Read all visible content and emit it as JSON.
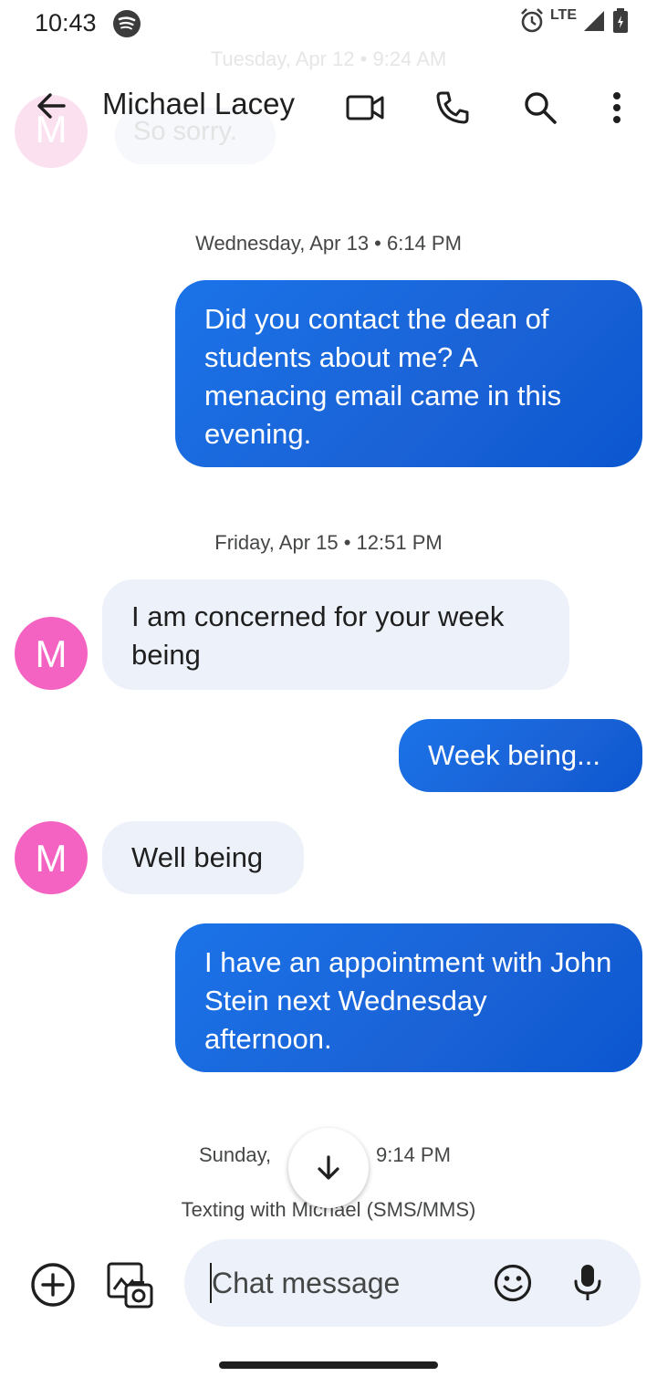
{
  "status_bar": {
    "time": "10:43",
    "network": "LTE"
  },
  "background": {
    "previous_date": "Tuesday, Apr 12 • 9:24 AM",
    "previous_message": "So sorry.",
    "previous_avatar": "M"
  },
  "header": {
    "title": "Michael Lacey",
    "icons": [
      "back-arrow-icon",
      "video-call-icon",
      "phone-icon",
      "search-icon",
      "more-vert-icon"
    ]
  },
  "conversation": {
    "date_wed": "Wednesday, Apr 13 • 6:14 PM",
    "msg1": "Did you contact the dean of students about me? A menacing email came in this evening.",
    "date_fri": "Friday, Apr 15 • 12:51 PM",
    "msg2": "I am concerned for your week being",
    "msg3": "Week being...",
    "msg4": "Well being",
    "msg5": "I have an appointment with John Stein next Wednesday afternoon.",
    "date_sun_left": "Sunday,",
    "date_sun_right": "9:14 PM",
    "texting_info": "Texting with Michael (SMS/MMS)",
    "avatar_letter": "M"
  },
  "compose": {
    "placeholder": "Chat message"
  },
  "colors": {
    "outgoing_bubble": "#1b73e8",
    "incoming_bubble": "#edf1f9",
    "avatar": "#f462c2"
  }
}
